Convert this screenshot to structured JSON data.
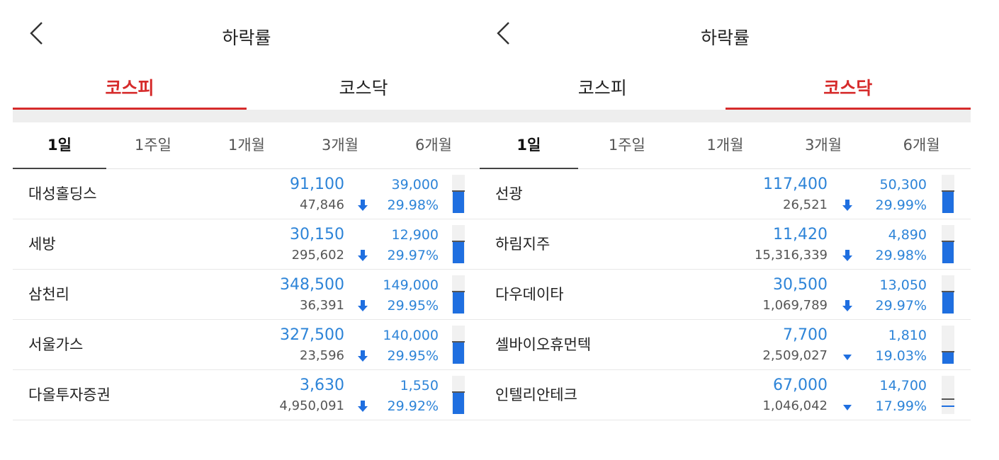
{
  "colors": {
    "accent": "#d62b2b",
    "down": "#2d84d8",
    "bar": "#1f6fe0"
  },
  "left": {
    "title": "하락률",
    "market_tabs": [
      {
        "label": "코스피",
        "active": true
      },
      {
        "label": "코스닥",
        "active": false
      }
    ],
    "period_tabs": [
      {
        "label": "1일",
        "active": true
      },
      {
        "label": "1주일",
        "active": false
      },
      {
        "label": "1개월",
        "active": false
      },
      {
        "label": "3개월",
        "active": false
      },
      {
        "label": "6개월",
        "active": false
      }
    ],
    "stocks": [
      {
        "name": "대성홀딩스",
        "price": "91,100",
        "volume": "47,846",
        "change": "39,000",
        "rate": "29.98%",
        "arrow": "down-arrow-icon",
        "bar_level": 0.55
      },
      {
        "name": "세방",
        "price": "30,150",
        "volume": "295,602",
        "change": "12,900",
        "rate": "29.97%",
        "arrow": "down-arrow-icon",
        "bar_level": 0.55
      },
      {
        "name": "삼천리",
        "price": "348,500",
        "volume": "36,391",
        "change": "149,000",
        "rate": "29.95%",
        "arrow": "down-arrow-icon",
        "bar_level": 0.55
      },
      {
        "name": "서울가스",
        "price": "327,500",
        "volume": "23,596",
        "change": "140,000",
        "rate": "29.95%",
        "arrow": "down-arrow-icon",
        "bar_level": 0.55
      },
      {
        "name": "다올투자증권",
        "price": "3,630",
        "volume": "4,950,091",
        "change": "1,550",
        "rate": "29.92%",
        "arrow": "down-arrow-icon",
        "bar_level": 0.55
      }
    ]
  },
  "right": {
    "title": "하락률",
    "market_tabs": [
      {
        "label": "코스피",
        "active": false
      },
      {
        "label": "코스닥",
        "active": true
      }
    ],
    "period_tabs": [
      {
        "label": "1일",
        "active": true
      },
      {
        "label": "1주일",
        "active": false
      },
      {
        "label": "1개월",
        "active": false
      },
      {
        "label": "3개월",
        "active": false
      },
      {
        "label": "6개월",
        "active": false
      }
    ],
    "stocks": [
      {
        "name": "선광",
        "price": "117,400",
        "volume": "26,521",
        "change": "50,300",
        "rate": "29.99%",
        "arrow": "down-arrow-icon",
        "bar_level": 0.55
      },
      {
        "name": "하림지주",
        "price": "11,420",
        "volume": "15,316,339",
        "change": "4,890",
        "rate": "29.98%",
        "arrow": "down-arrow-icon",
        "bar_level": 0.55
      },
      {
        "name": "다우데이타",
        "price": "30,500",
        "volume": "1,069,789",
        "change": "13,050",
        "rate": "29.97%",
        "arrow": "down-arrow-icon",
        "bar_level": 0.55
      },
      {
        "name": "셀바이오휴먼텍",
        "price": "7,700",
        "volume": "2,509,027",
        "change": "1,810",
        "rate": "19.03%",
        "arrow": "down-triangle-icon",
        "bar_level": 0.3
      },
      {
        "name": "인텔리안테크",
        "price": "67,000",
        "volume": "1,046,042",
        "change": "14,700",
        "rate": "17.99%",
        "arrow": "down-triangle-icon",
        "bar_level": 0.0
      }
    ]
  }
}
